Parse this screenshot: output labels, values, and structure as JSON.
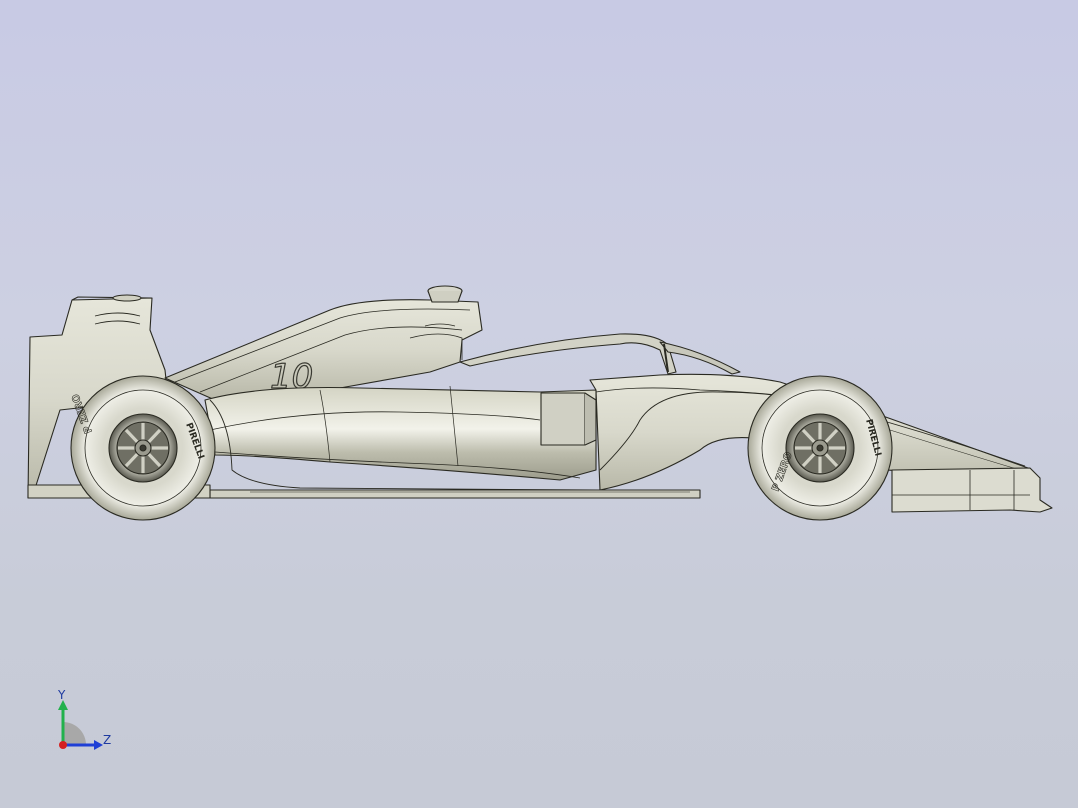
{
  "viewport": {
    "background_top": "#c8cae4",
    "background_bottom": "#c6cad6"
  },
  "model": {
    "car_number": "10",
    "tire_brand": "PIRELLI",
    "tire_model": "P ZERO",
    "body_color": "#dcdcd0",
    "line_color": "#2a2a22"
  },
  "triad": {
    "y_label": "Y",
    "z_label": "Z",
    "y_color": "#22b14c",
    "z_color": "#1f3fd6",
    "x_color": "#d42020"
  }
}
